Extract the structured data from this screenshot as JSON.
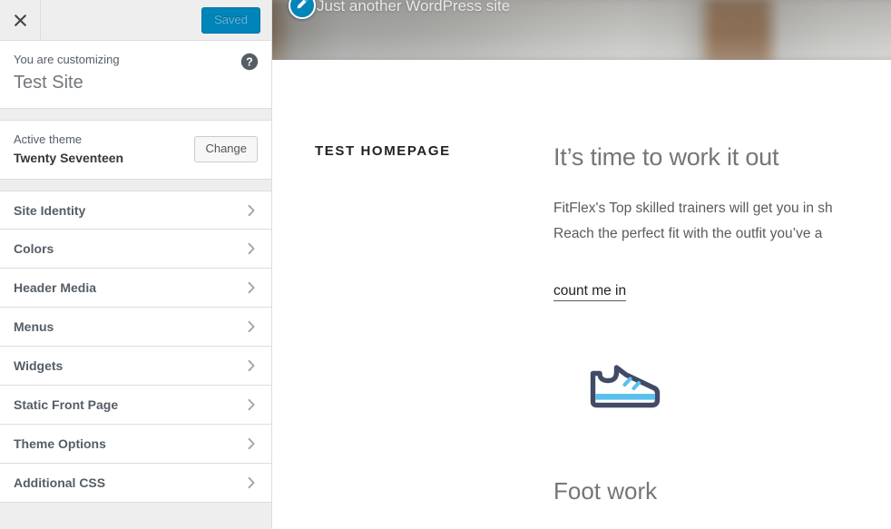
{
  "customizer": {
    "close_label": "Close",
    "close_icon": "close-icon",
    "save_button_label": "Saved",
    "help_icon": "help-circle-icon",
    "help_label": "Help",
    "info_label": "You are customizing",
    "site_title": "Test Site",
    "theme_label": "Active theme",
    "theme_name": "Twenty Seventeen",
    "change_button_label": "Change",
    "chevron_icon": "chevron-right-icon",
    "sections": [
      {
        "label": "Site Identity"
      },
      {
        "label": "Colors"
      },
      {
        "label": "Header Media"
      },
      {
        "label": "Menus"
      },
      {
        "label": "Widgets"
      },
      {
        "label": "Static Front Page"
      },
      {
        "label": "Theme Options"
      },
      {
        "label": "Additional CSS"
      }
    ]
  },
  "preview": {
    "site_tagline": "Just another WordPress site",
    "edit_icon": "pencil-edit-icon",
    "panel_title": "Test Homepage",
    "entry_title": "It’s time to work it out",
    "entry_text_line1": "FitFlex's Top skilled trainers will get you in sh",
    "entry_text_line2": "Reach the perfect fit with the outfit you’ve a",
    "entry_link_label": "count me in",
    "shoe_icon": "sneaker-icon",
    "subsection_title": "Foot work"
  },
  "colors": {
    "accent_blue": "#0085ba",
    "sidebar_bg": "#eeeeee",
    "panel_bg": "#ffffff",
    "border": "#dddddd",
    "text_muted": "#555d66",
    "shoe_outline": "#414b68",
    "shoe_accent": "#5bc0ee"
  }
}
